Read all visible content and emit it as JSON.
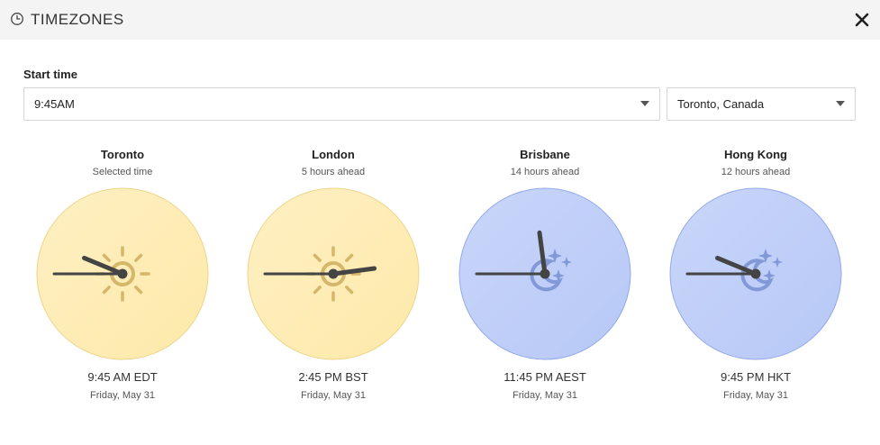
{
  "header": {
    "title": "TIMEZONES",
    "icon": "clock-icon",
    "close_icon": "close-icon"
  },
  "start": {
    "label": "Start time",
    "time_value": "9:45AM",
    "zone_value": "Toronto, Canada"
  },
  "colors": {
    "day_fill": "#fde9a8",
    "night_fill": "#b7c8f6",
    "hand": "#444444"
  },
  "clocks": [
    {
      "city": "Toronto",
      "offset": "Selected time",
      "time": "9:45 AM EDT",
      "date": "Friday, May 31",
      "mode": "day",
      "hour": 9,
      "minute": 45,
      "icon": "sun-icon"
    },
    {
      "city": "London",
      "offset": "5 hours ahead",
      "time": "2:45 PM BST",
      "date": "Friday, May 31",
      "mode": "day",
      "hour": 2,
      "minute": 45,
      "icon": "sun-icon"
    },
    {
      "city": "Brisbane",
      "offset": "14 hours ahead",
      "time": "11:45 PM AEST",
      "date": "Friday, May 31",
      "mode": "night",
      "hour": 11,
      "minute": 45,
      "icon": "moon-stars-icon"
    },
    {
      "city": "Hong Kong",
      "offset": "12 hours ahead",
      "time": "9:45 PM HKT",
      "date": "Friday, May 31",
      "mode": "night",
      "hour": 9,
      "minute": 45,
      "icon": "moon-stars-icon"
    }
  ]
}
